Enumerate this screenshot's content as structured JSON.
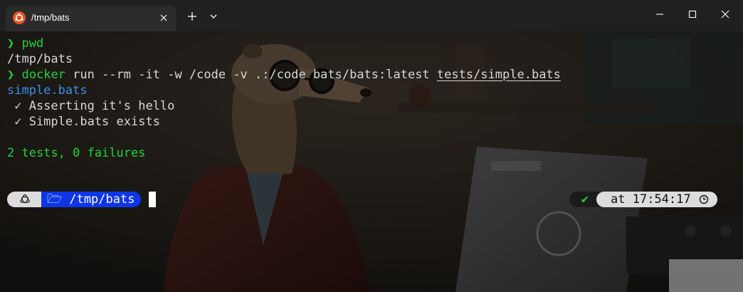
{
  "tab": {
    "title": "/tmp/bats",
    "icon": "ubuntu-logo-icon",
    "icon_color": "#e95420"
  },
  "titlebar": {
    "new_tab_label": "+",
    "dropdown_icon": "chevron-down-icon",
    "window_controls": [
      "minimize-icon",
      "maximize-icon",
      "close-icon"
    ]
  },
  "terminal": {
    "prompt_symbol": "❯",
    "lines": [
      {
        "cmd": "pwd"
      },
      {
        "output": "/tmp/bats"
      },
      {
        "cmd": "docker",
        "args": " run --rm -it -w /code -v .:/code bats/bats:latest ",
        "arg_path": "tests/simple.bats"
      },
      {
        "output": "simple.bats"
      },
      {
        "output": " ✓ Asserting it's hello"
      },
      {
        "output": " ✓ Simple.bats exists"
      },
      {
        "output": ""
      },
      {
        "output": "2 tests, 0 failures"
      }
    ],
    "colors": {
      "prompt": "#23d13a",
      "file_header": "#3b8eea",
      "summary": "#23d13a",
      "path_segment_bg": "#0c36e8"
    }
  },
  "prompt_bar": {
    "os_icon": "ubuntu-logo-icon",
    "folder_icon": "folder-open-icon",
    "folder_glyph": "🗁",
    "path": "/tmp/bats",
    "status_glyph": "✔",
    "time_prefix": "at",
    "time": "17:54:17",
    "clock_icon": "clock-icon"
  }
}
